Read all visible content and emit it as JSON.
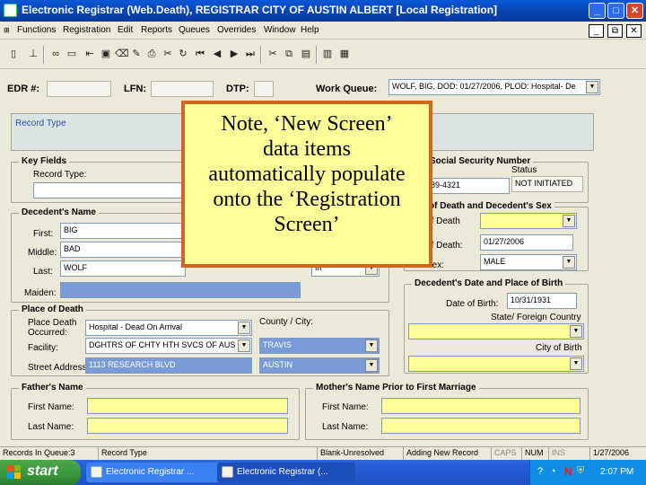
{
  "window": {
    "title": "Electronic Registrar (Web.Death), REGISTRAR   CITY OF AUSTIN   ALBERT   [Local Registration]",
    "controls": {
      "minimize": "_",
      "maximize": "□",
      "close": "✕"
    }
  },
  "menu": {
    "items": [
      "Functions",
      "Registration",
      "Edit",
      "Reports",
      "Queues",
      "Overrides",
      "Window",
      "Help"
    ],
    "doc_controls": {
      "minimize": "_",
      "restore": "⧉",
      "close": "✕"
    }
  },
  "header": {
    "edr_label": "EDR #:",
    "lfn_label": "LFN:",
    "dtp_label": "DTP:",
    "work_queue_label": "Work Queue:",
    "work_queue_value": "WOLF, BIG, DOD: 01/27/2006, PLOD: Hospital- De"
  },
  "record_type_label": "Record Type",
  "key_fields": {
    "title": "Key Fields",
    "record_type_label": "Record Type:",
    "ssn_title": "Social Security Number",
    "ssn_value": "89-4321",
    "status_label": "Status",
    "status_value": "NOT INITIATED"
  },
  "decedent_name": {
    "title": "Decedent's Name",
    "first_label": "First:",
    "first_value": "BIG",
    "middle_label": "Middle:",
    "middle_value": "BAD",
    "last_label": "Last:",
    "last_value": "WOLF",
    "suffix_value": "III",
    "maiden_label": "Maiden:"
  },
  "death_sex": {
    "title": "of Death and Decedent's Sex",
    "type_label": "of Death",
    "date_label": "of Death:",
    "date_value": "01/27/2006",
    "sex_label": "Sex:",
    "sex_value": "MALE"
  },
  "birth": {
    "title": "Decedent's Date and Place of Birth",
    "dob_label": "Date of Birth:",
    "dob_value": "10/31/1931",
    "state_label": "State/ Foreign Country",
    "city_label": "City of Birth"
  },
  "place_of_death": {
    "title": "Place of Death",
    "occurred_label": "Place Death Occurred:",
    "occurred_value": "Hospital - Dead On Arrival",
    "county_label": "County / City:",
    "facility_label": "Facility:",
    "facility_value": "DGHTRS OF CHTY HTH SVCS OF AUS",
    "county_value": "TRAVIS",
    "street_label": "Street Address:",
    "street_value": "1113 RESEARCH BLVD",
    "city_value": "AUSTIN"
  },
  "father": {
    "title": "Father's Name",
    "first_label": "First Name:",
    "last_label": "Last Name:"
  },
  "mother": {
    "title": "Mother's Name Prior to First Marriage",
    "first_label": "First Name:",
    "last_label": "Last Name:"
  },
  "status_bar": {
    "queue": "Records In Queue:3",
    "record_type": "Record Type",
    "blank": "Blank-Unresolved",
    "mode": "Adding New Record",
    "caps": "CAPS",
    "num": "NUM",
    "ins": "INS",
    "date": "1/27/2006"
  },
  "taskbar": {
    "start": "start",
    "task1": "Electronic Registrar ...",
    "task2": "Electronic Registrar (...",
    "clock": "2:07 PM"
  },
  "callout": {
    "line1": "Note, ‘New Screen’",
    "line2": "data items",
    "line3": "automatically populate",
    "line4": "onto the ‘Registration",
    "line5": "Screen’"
  },
  "colors": {
    "callout_fill": "#ffff99",
    "callout_border": "#d2661e",
    "required_field": "#ffff99",
    "auto_field": "#7a9ad8"
  }
}
